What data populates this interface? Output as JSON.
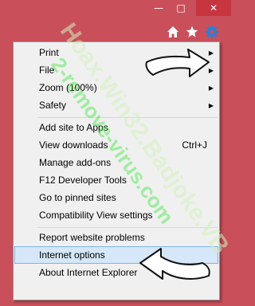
{
  "window": {
    "minimize_icon": "minimize-icon",
    "maximize_icon": "maximize-icon",
    "close_icon": "close-icon",
    "accent_color": "#c9505b",
    "close_color": "#c7353f"
  },
  "toolbar": {
    "icons": [
      "home-icon",
      "star-icon",
      "gear-icon"
    ]
  },
  "menu": {
    "items": [
      {
        "label": "Print",
        "submenu": "▶"
      },
      {
        "label": "File",
        "submenu": "▶"
      },
      {
        "label": "Zoom (100%)",
        "submenu": "▶"
      },
      {
        "label": "Safety",
        "submenu": "▶"
      },
      {
        "label": "Add site to Apps"
      },
      {
        "label": "View downloads",
        "shortcut": "Ctrl+J"
      },
      {
        "label": "Manage add-ons"
      },
      {
        "label": "F12 Developer Tools"
      },
      {
        "label": "Go to pinned sites"
      },
      {
        "label": "Compatibility View settings"
      },
      {
        "label": "Report website problems"
      },
      {
        "label": "Internet options",
        "highlighted": true
      },
      {
        "label": "About Internet Explorer"
      }
    ],
    "highlight_color": "#d5e7f8"
  },
  "watermark": {
    "line1": "Hoax.Win32.Badjoke.VB",
    "line2": "2-remove-virus.com"
  }
}
